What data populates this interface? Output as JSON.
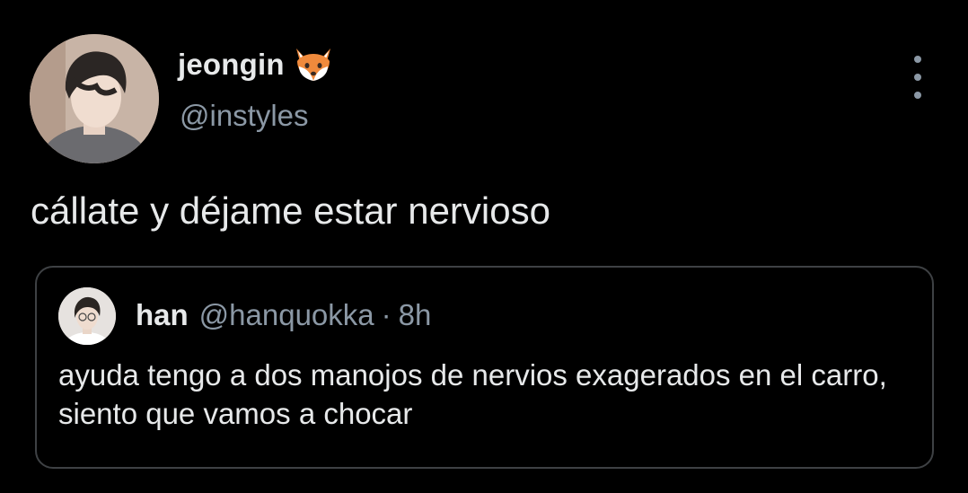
{
  "tweet": {
    "author": {
      "display_name": "jeongin",
      "emoji_icon": "fox-face-icon",
      "handle": "@instyles"
    },
    "text": "cállate y déjame estar nervioso",
    "more_icon": "more-vertical-icon"
  },
  "quoted_tweet": {
    "author": {
      "display_name": "han",
      "handle": "@hanquokka"
    },
    "separator": "·",
    "time": "8h",
    "text": "ayuda tengo a dos manojos de nervios exagerados en el carro, siento que vamos a chocar"
  },
  "colors": {
    "background": "#000000",
    "primary_text": "#e7e9ea",
    "secondary_text": "#8b98a5",
    "card_border": "#3e4144"
  }
}
